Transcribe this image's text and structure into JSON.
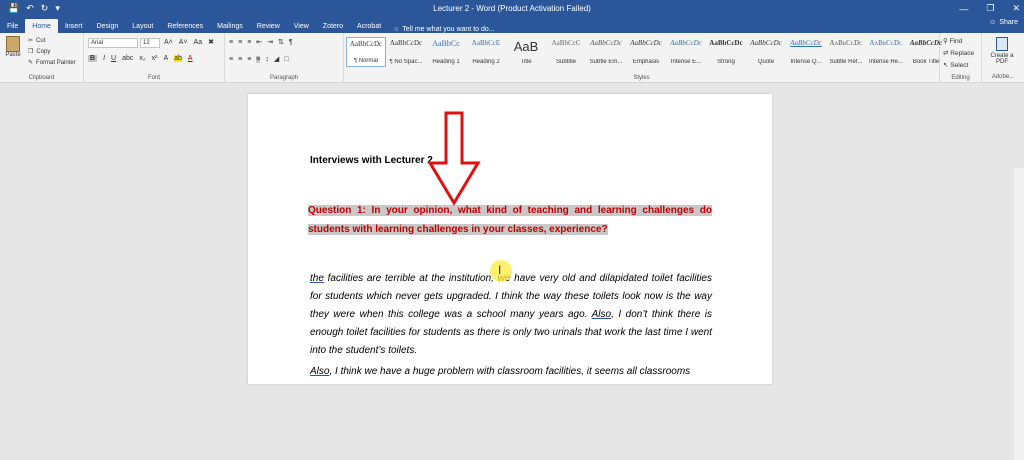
{
  "window": {
    "title": "Lecturer 2 - Word (Product Activation Failed)",
    "qat_icons": [
      "save-icon",
      "undo-icon",
      "redo-icon",
      "customize-icon"
    ],
    "controls": [
      "minimize-icon",
      "restore-icon",
      "close-icon"
    ]
  },
  "tabs": [
    "File",
    "Home",
    "Insert",
    "Design",
    "Layout",
    "References",
    "Mailings",
    "Review",
    "View",
    "Zotero",
    "Acrobat"
  ],
  "active_tab": "Home",
  "tell_me": "Tell me what you want to do...",
  "share_label": "Share",
  "ribbon": {
    "clipboard": {
      "paste": "Paste",
      "cut": "Cut",
      "copy": "Copy",
      "format_painter": "Format Painter",
      "label": "Clipboard"
    },
    "font": {
      "name": "Arial",
      "size": "12",
      "label": "Font"
    },
    "paragraph": {
      "label": "Paragraph"
    },
    "styles": {
      "label": "Styles",
      "items": [
        {
          "preview": "AaBbCcDc",
          "name": "¶ Normal"
        },
        {
          "preview": "AaBbCcDc",
          "name": "¶ No Spac..."
        },
        {
          "preview": "AaBbCc",
          "name": "Heading 1"
        },
        {
          "preview": "AaBbCcE",
          "name": "Heading 2"
        },
        {
          "preview": "AaB",
          "name": "Title"
        },
        {
          "preview": "AaBbCcC",
          "name": "Subtitle"
        },
        {
          "preview": "AaBbCcDc",
          "name": "Subtle Em..."
        },
        {
          "preview": "AaBbCcDc",
          "name": "Emphasis"
        },
        {
          "preview": "AaBbCcDc",
          "name": "Intense E..."
        },
        {
          "preview": "AaBbCcDc",
          "name": "Strong"
        },
        {
          "preview": "AaBbCcDc",
          "name": "Quote"
        },
        {
          "preview": "AaBbCcDc",
          "name": "Intense Q..."
        },
        {
          "preview": "AaBbCcDc",
          "name": "Subtle Ref..."
        },
        {
          "preview": "AaBbCcDc",
          "name": "Intense Re..."
        },
        {
          "preview": "AaBbCcDc",
          "name": "Book Title"
        }
      ]
    },
    "editing": {
      "find": "Find",
      "replace": "Replace",
      "select": "Select",
      "label": "Editing"
    },
    "adobe": {
      "create_pdf": "Create a PDF",
      "label": "Adobe..."
    }
  },
  "document": {
    "heading": "Interviews with Lecturer 2",
    "question": "Question 1: In your opinion, what kind of teaching and learning challenges do students with learning challenges in your classes, experience?",
    "answer_p1": {
      "start": "the",
      "body1": " facilities are terrible at the institution, we have very old and dilapidated toilet facilities for students which never gets upgraded. I think the way these toilets look now is the way they were when this college was a school many years ago. ",
      "also": "Also",
      "body2": ", I don’t think there is enough toilet facilities for students as there is only two urinals that work the last time I went into the student’s toilets."
    },
    "answer_p2": {
      "also": "Also",
      "body": ", I think we have a huge problem with classroom facilities, it seems all classrooms"
    }
  }
}
